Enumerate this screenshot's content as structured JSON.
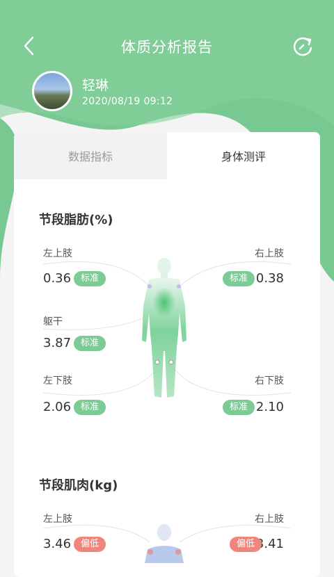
{
  "header": {
    "title": "体质分析报告"
  },
  "user": {
    "name": "轻琳",
    "timestamp": "2020/08/19    09:12"
  },
  "tabs": [
    {
      "label": "数据指标",
      "active": false
    },
    {
      "label": "身体测评",
      "active": true
    }
  ],
  "fat_section": {
    "title": "节段脂肪(%)",
    "left_arm": {
      "label": "左上肢",
      "value": "0.36",
      "status": "标准"
    },
    "right_arm": {
      "label": "右上肢",
      "value": "0.38",
      "status": "标准"
    },
    "trunk": {
      "label": "躯干",
      "value": "3.87",
      "status": "标准"
    },
    "left_leg": {
      "label": "左下肢",
      "value": "2.06",
      "status": "标准"
    },
    "right_leg": {
      "label": "右下肢",
      "value": "2.10",
      "status": "标准"
    }
  },
  "muscle_section": {
    "title": "节段肌肉(kg)",
    "left_arm": {
      "label": "左上肢",
      "value": "3.46",
      "status": "偏低"
    },
    "right_arm": {
      "label": "右上肢",
      "value": "3.41",
      "status": "偏低"
    }
  },
  "colors": {
    "theme_green": "#7ccb95",
    "status_standard": "#7ccb95",
    "status_low": "#f0857b"
  },
  "icons": {
    "back": "chevron-left-icon",
    "refresh": "refresh-icon"
  }
}
